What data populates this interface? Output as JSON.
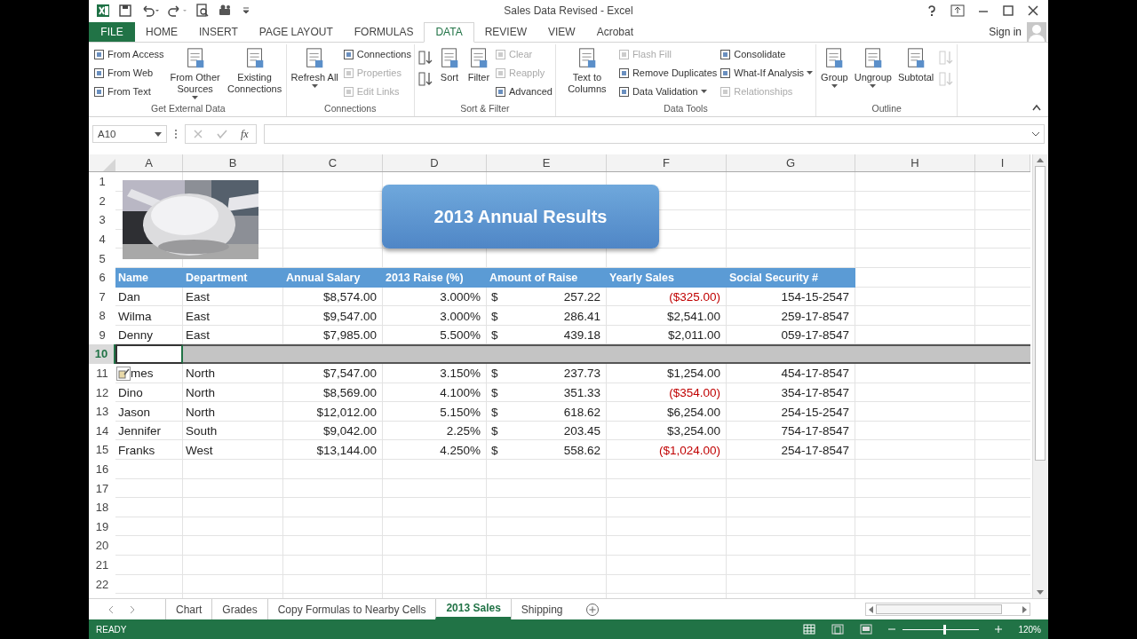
{
  "window": {
    "title": "Sales Data Revised - Excel"
  },
  "ribbon_tabs": [
    {
      "label": "FILE",
      "kind": "file",
      "selected": false
    },
    {
      "label": "HOME",
      "kind": "tab",
      "selected": false
    },
    {
      "label": "INSERT",
      "kind": "tab",
      "selected": false
    },
    {
      "label": "PAGE LAYOUT",
      "kind": "tab",
      "selected": false
    },
    {
      "label": "FORMULAS",
      "kind": "tab",
      "selected": false
    },
    {
      "label": "DATA",
      "kind": "tab",
      "selected": true
    },
    {
      "label": "REVIEW",
      "kind": "tab",
      "selected": false
    },
    {
      "label": "VIEW",
      "kind": "tab",
      "selected": false
    },
    {
      "label": "Acrobat",
      "kind": "tab",
      "selected": false
    }
  ],
  "sign_in": "Sign in",
  "ribbon_groups": [
    {
      "label": "Get External Data",
      "columns": [
        {
          "kind": "small",
          "items": [
            {
              "label": "From Access",
              "disabled": false,
              "dropdown": false
            },
            {
              "label": "From Web",
              "disabled": false,
              "dropdown": false
            },
            {
              "label": "From Text",
              "disabled": false,
              "dropdown": false
            }
          ]
        },
        {
          "kind": "large",
          "items": [
            {
              "label": "From Other Sources",
              "disabled": false,
              "dropdown": true
            }
          ]
        },
        {
          "kind": "large",
          "items": [
            {
              "label": "Existing Connections",
              "disabled": false,
              "dropdown": false
            }
          ]
        }
      ]
    },
    {
      "label": "Connections",
      "columns": [
        {
          "kind": "large",
          "items": [
            {
              "label": "Refresh All",
              "disabled": false,
              "dropdown": true
            }
          ]
        },
        {
          "kind": "small",
          "items": [
            {
              "label": "Connections",
              "disabled": false,
              "dropdown": false
            },
            {
              "label": "Properties",
              "disabled": true,
              "dropdown": false
            },
            {
              "label": "Edit Links",
              "disabled": true,
              "dropdown": false
            }
          ]
        }
      ]
    },
    {
      "label": "Sort & Filter",
      "columns": [
        {
          "kind": "icons",
          "items": [
            {
              "disabled": false
            },
            {
              "disabled": false
            }
          ]
        },
        {
          "kind": "large",
          "items": [
            {
              "label": "Sort",
              "disabled": false,
              "dropdown": false
            }
          ]
        },
        {
          "kind": "large",
          "items": [
            {
              "label": "Filter",
              "disabled": false,
              "dropdown": false
            }
          ]
        },
        {
          "kind": "small",
          "items": [
            {
              "label": "Clear",
              "disabled": true,
              "dropdown": false
            },
            {
              "label": "Reapply",
              "disabled": true,
              "dropdown": false
            },
            {
              "label": "Advanced",
              "disabled": false,
              "dropdown": false
            }
          ]
        }
      ]
    },
    {
      "label": "Data Tools",
      "columns": [
        {
          "kind": "large",
          "items": [
            {
              "label": "Text to Columns",
              "disabled": false,
              "dropdown": false
            }
          ]
        },
        {
          "kind": "small",
          "items": [
            {
              "label": "Flash Fill",
              "disabled": true,
              "dropdown": false
            },
            {
              "label": "Remove Duplicates",
              "disabled": false,
              "dropdown": false
            },
            {
              "label": "Data Validation",
              "disabled": false,
              "dropdown": true
            }
          ]
        },
        {
          "kind": "small",
          "items": [
            {
              "label": "Consolidate",
              "disabled": false,
              "dropdown": false
            },
            {
              "label": "What-If Analysis",
              "disabled": false,
              "dropdown": true
            },
            {
              "label": "Relationships",
              "disabled": true,
              "dropdown": false
            }
          ]
        }
      ]
    },
    {
      "label": "Outline",
      "columns": [
        {
          "kind": "large",
          "items": [
            {
              "label": "Group",
              "disabled": false,
              "dropdown": true
            }
          ]
        },
        {
          "kind": "large",
          "items": [
            {
              "label": "Ungroup",
              "disabled": false,
              "dropdown": true
            }
          ]
        },
        {
          "kind": "large",
          "items": [
            {
              "label": "Subtotal",
              "disabled": false,
              "dropdown": false
            }
          ]
        },
        {
          "kind": "icons",
          "items": [
            {
              "disabled": true
            },
            {
              "disabled": true
            }
          ]
        }
      ]
    }
  ],
  "formula_bar": {
    "name_box": "A10",
    "function_label": "fx"
  },
  "sheet": {
    "columns": [
      {
        "label": "A"
      },
      {
        "label": "B"
      },
      {
        "label": "C"
      },
      {
        "label": "D"
      },
      {
        "label": "E"
      },
      {
        "label": "F"
      },
      {
        "label": "G"
      },
      {
        "label": "H"
      },
      {
        "label": "I"
      }
    ],
    "title_shape": "2013 Annual Results",
    "rows": [
      {
        "number": "1",
        "kind": "blank",
        "selected": false
      },
      {
        "number": "2",
        "kind": "blank",
        "selected": false
      },
      {
        "number": "3",
        "kind": "blank",
        "selected": false
      },
      {
        "number": "4",
        "kind": "blank",
        "selected": false
      },
      {
        "number": "5",
        "kind": "blank",
        "selected": false
      },
      {
        "number": "6",
        "kind": "header",
        "selected": false,
        "cells": [
          "Name",
          "Department",
          "Annual Salary",
          "2013 Raise (%)",
          "Amount of Raise",
          "Yearly Sales",
          "Social Security #"
        ]
      },
      {
        "number": "7",
        "kind": "data",
        "selected": false,
        "paste_options": false,
        "name": "Dan",
        "department": "East",
        "salary": "$8,574.00",
        "raise": "3.000%",
        "currency": "$",
        "amount": "257.22",
        "sales": "($325.00)",
        "sales_negative": true,
        "ssn": "154-15-2547"
      },
      {
        "number": "8",
        "kind": "data",
        "selected": false,
        "paste_options": false,
        "name": "Wilma",
        "department": "East",
        "salary": "$9,547.00",
        "raise": "3.000%",
        "currency": "$",
        "amount": "286.41",
        "sales": "$2,541.00",
        "sales_negative": false,
        "ssn": "259-17-8547"
      },
      {
        "number": "9",
        "kind": "data",
        "selected": false,
        "paste_options": false,
        "name": "Denny",
        "department": "East",
        "salary": "$7,985.00",
        "raise": "5.500%",
        "currency": "$",
        "amount": "439.18",
        "sales": "$2,011.00",
        "sales_negative": false,
        "ssn": "059-17-8547"
      },
      {
        "number": "10",
        "kind": "blank",
        "selected": true
      },
      {
        "number": "11",
        "kind": "data",
        "selected": false,
        "paste_options": true,
        "name": "mes",
        "department": "North",
        "salary": "$7,547.00",
        "raise": "3.150%",
        "currency": "$",
        "amount": "237.73",
        "sales": "$1,254.00",
        "sales_negative": false,
        "ssn": "454-17-8547"
      },
      {
        "number": "12",
        "kind": "data",
        "selected": false,
        "paste_options": false,
        "name": "Dino",
        "department": "North",
        "salary": "$8,569.00",
        "raise": "4.100%",
        "currency": "$",
        "amount": "351.33",
        "sales": "($354.00)",
        "sales_negative": true,
        "ssn": "354-17-8547"
      },
      {
        "number": "13",
        "kind": "data",
        "selected": false,
        "paste_options": false,
        "name": "Jason",
        "department": "North",
        "salary": "$12,012.00",
        "raise": "5.150%",
        "currency": "$",
        "amount": "618.62",
        "sales": "$6,254.00",
        "sales_negative": false,
        "ssn": "254-15-2547"
      },
      {
        "number": "14",
        "kind": "data",
        "selected": false,
        "paste_options": false,
        "name": "Jennifer",
        "department": "South",
        "salary": "$9,042.00",
        "raise": "2.25%",
        "currency": "$",
        "amount": "203.45",
        "sales": "$3,254.00",
        "sales_negative": false,
        "ssn": "754-17-8547"
      },
      {
        "number": "15",
        "kind": "data",
        "selected": false,
        "paste_options": false,
        "name": "Franks",
        "department": "West",
        "salary": "$13,144.00",
        "raise": "4.250%",
        "currency": "$",
        "amount": "558.62",
        "sales": "($1,024.00)",
        "sales_negative": true,
        "ssn": "254-17-8547"
      },
      {
        "number": "16",
        "kind": "blank",
        "selected": false
      },
      {
        "number": "17",
        "kind": "blank",
        "selected": false
      },
      {
        "number": "18",
        "kind": "blank",
        "selected": false
      },
      {
        "number": "19",
        "kind": "blank",
        "selected": false
      },
      {
        "number": "20",
        "kind": "blank",
        "selected": false
      },
      {
        "number": "21",
        "kind": "blank",
        "selected": false
      },
      {
        "number": "22",
        "kind": "blank",
        "selected": false
      }
    ]
  },
  "sheet_tabs": [
    {
      "label": "Chart",
      "selected": false
    },
    {
      "label": "Grades",
      "selected": false
    },
    {
      "label": "Copy Formulas to Nearby Cells",
      "selected": false
    },
    {
      "label": "2013 Sales",
      "selected": true
    },
    {
      "label": "Shipping",
      "selected": false
    }
  ],
  "status_bar": {
    "mode": "READY",
    "zoom": "120%",
    "level": 0.54
  }
}
